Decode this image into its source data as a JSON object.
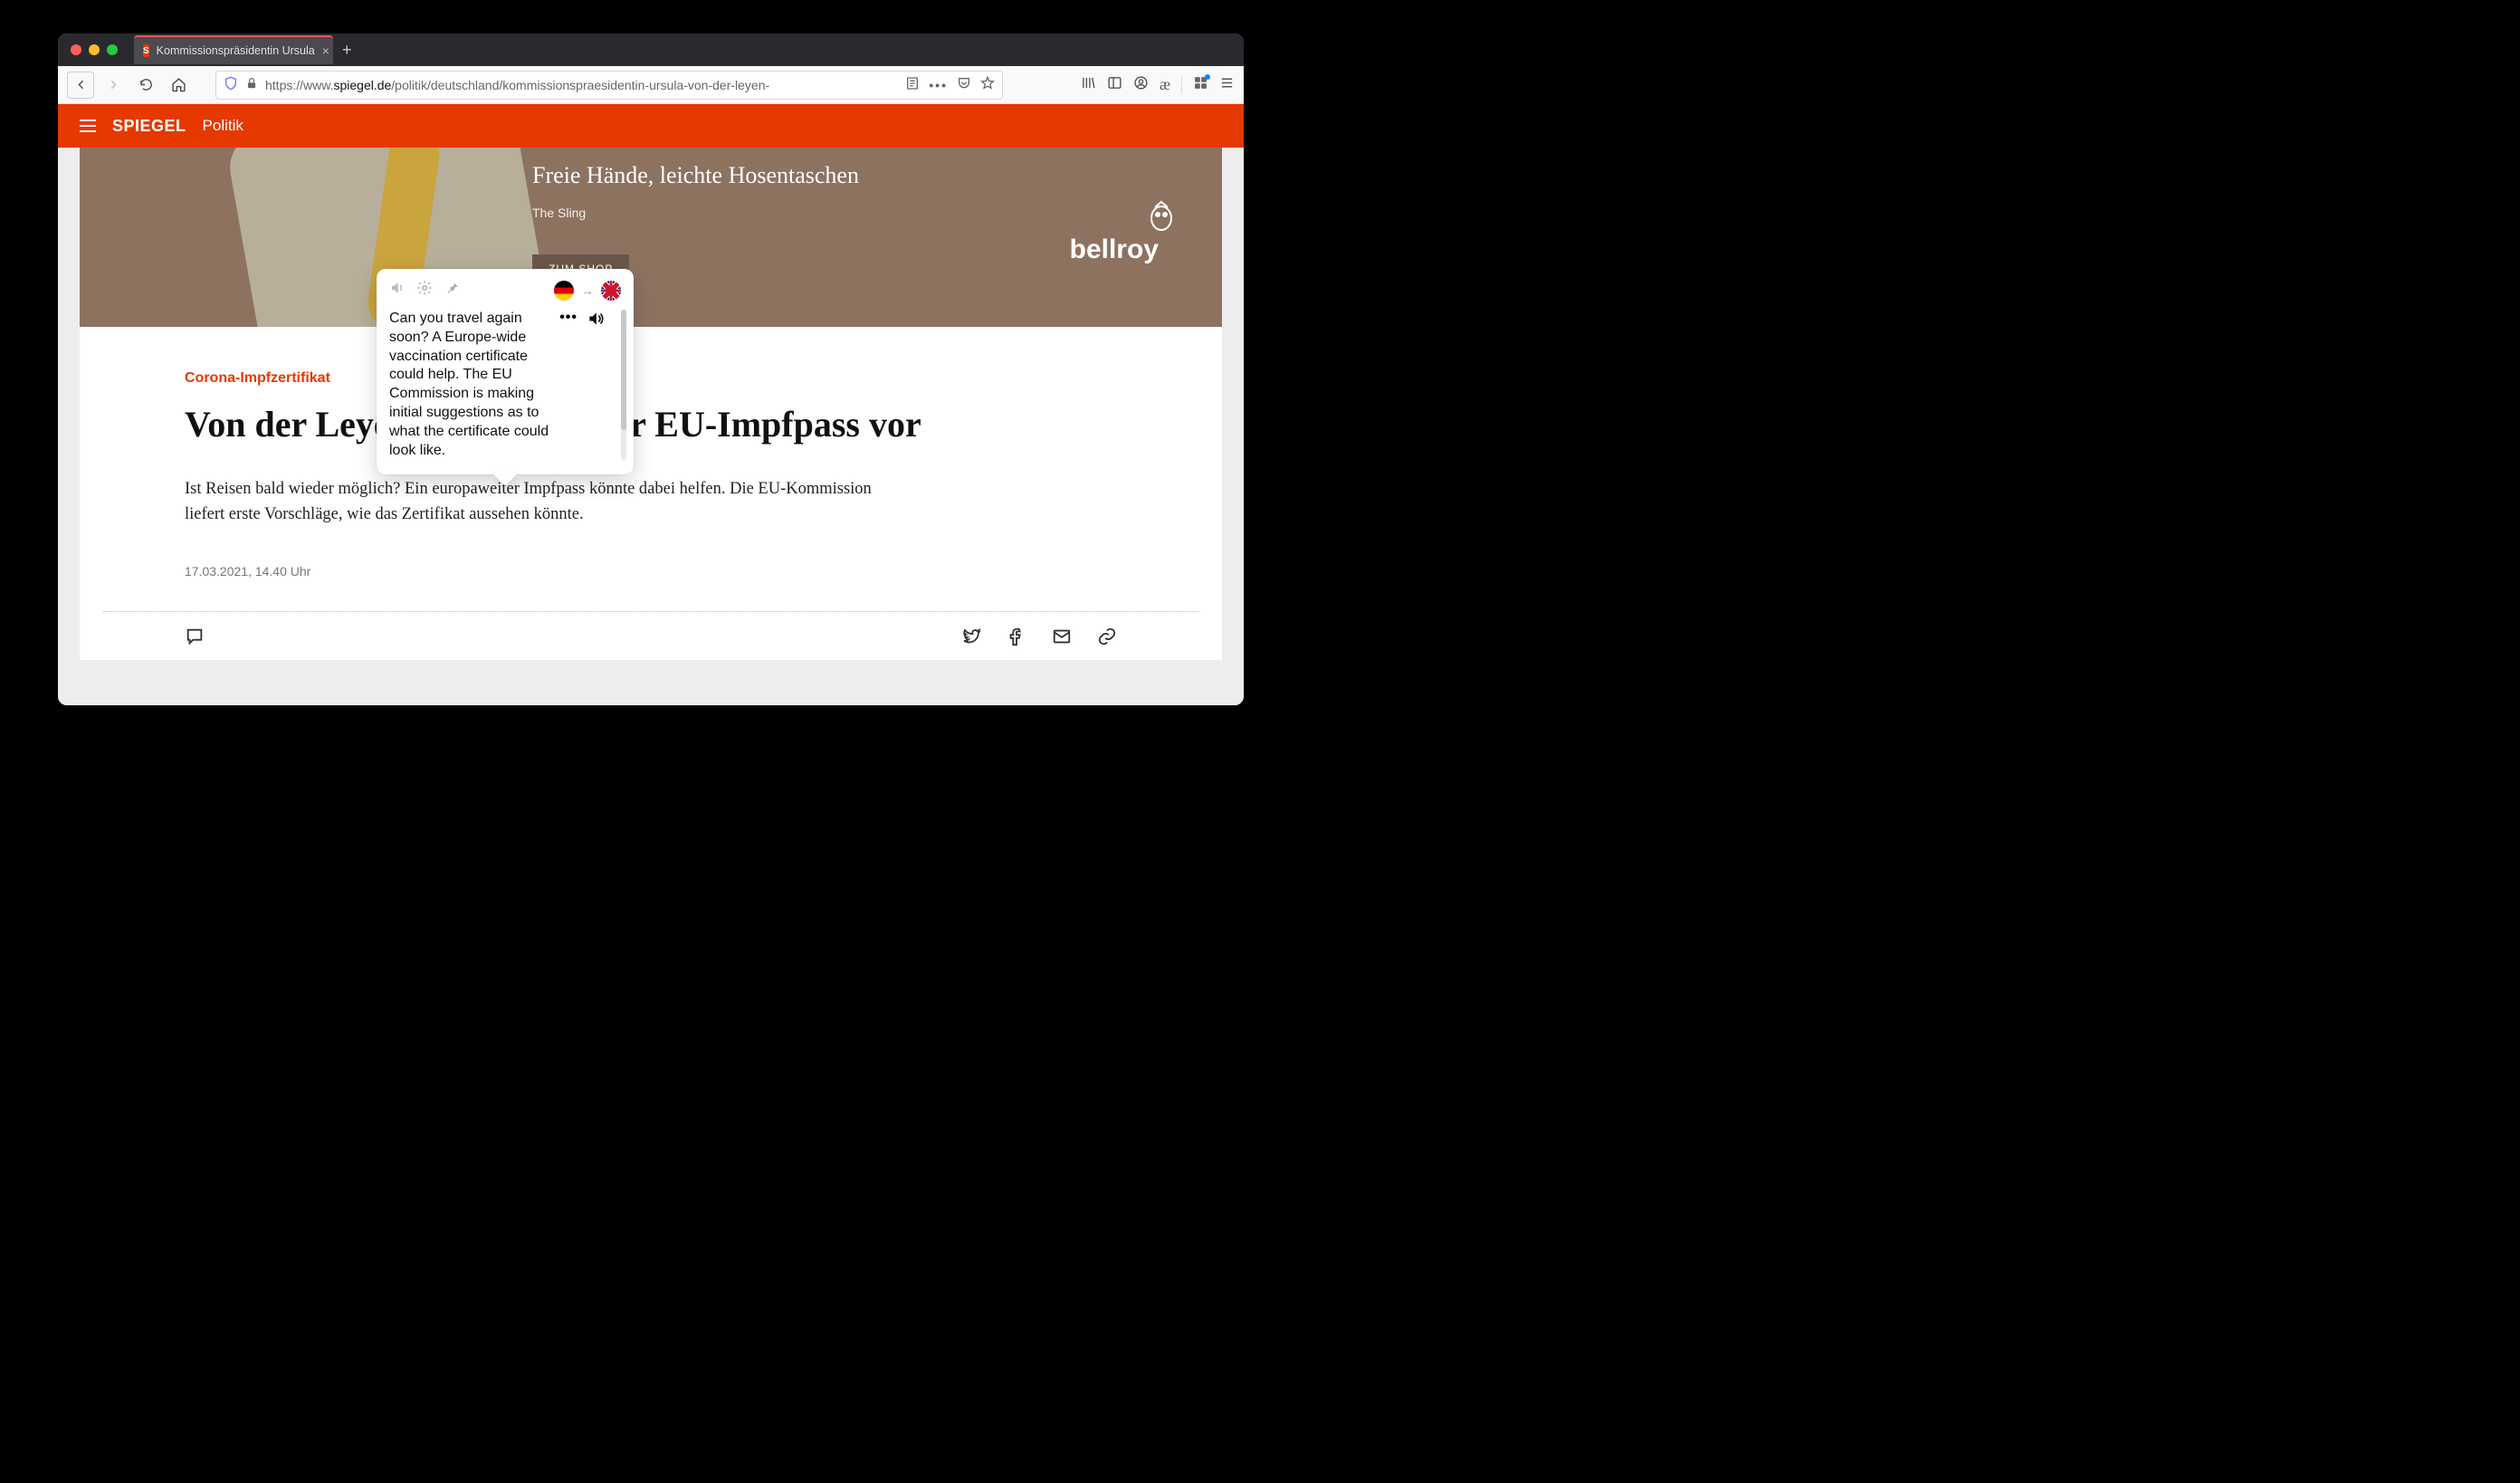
{
  "window": {
    "tab_title": "Kommissionspräsidentin Ursula",
    "url_prefix": "https://www.",
    "url_host": "spiegel.de",
    "url_path": "/politik/deutschland/kommissionspraesidentin-ursula-von-der-leyen-"
  },
  "site": {
    "logo": "SPIEGEL",
    "section": "Politik"
  },
  "ad": {
    "headline": "Freie Hände, leichte Hosentaschen",
    "sub": "The Sling",
    "cta": "ZUM SHOP",
    "brand": "bellroy"
  },
  "article": {
    "kicker": "Corona-Impfzertifikat",
    "headline": "Von der Leyen stellt Pläne für EU-Impfpass vor",
    "lede": "Ist Reisen bald wieder möglich? Ein europaweiter Impfpass könnte dabei helfen. Die EU-Kommission liefert erste Vorschläge, wie das Zertifikat aussehen könnte.",
    "timestamp": "17.03.2021, 14.40 Uhr"
  },
  "translator": {
    "from_lang": "de",
    "to_lang": "en",
    "text": "Can you travel again soon? A Europe-wide vaccination certificate could help. The EU Commission is making initial suggestions as to what the certificate could look like."
  },
  "icons": {
    "favicon_glyph": "S",
    "ae": "æ",
    "dots": "•••"
  }
}
